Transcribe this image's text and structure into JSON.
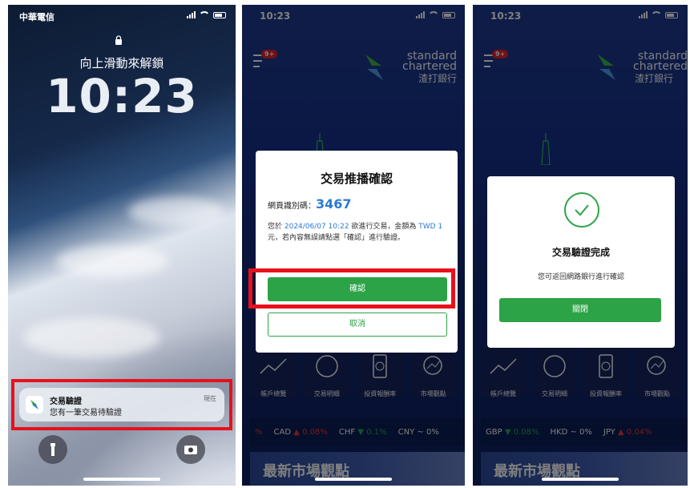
{
  "phone1": {
    "carrier": "中華電信",
    "unlock_hint": "向上滑動來解鎖",
    "time": "10:23",
    "notification": {
      "app": "交易驗證",
      "body": "您有一筆交易待驗證",
      "time": "現在"
    }
  },
  "app_common": {
    "time": "10:23",
    "badge": "9+",
    "brand_line1": "standard",
    "brand_line2": "chartered",
    "brand_cn": "渣打銀行",
    "tiles": [
      "帳戶總覽",
      "交易明細",
      "投資報酬率",
      "市場觀點"
    ],
    "banner": "最新市場觀點"
  },
  "phone2": {
    "ticker": [
      {
        "code": "%",
        "arrow": "",
        "change": ""
      },
      {
        "code": "CAD",
        "arrow": "▲",
        "change": "0.08%"
      },
      {
        "code": "CHF",
        "arrow": "▼",
        "change": "0.1%"
      },
      {
        "code": "CNY",
        "arrow": "~",
        "change": "0%"
      }
    ],
    "dialog": {
      "title": "交易推播確認",
      "code_label": "網頁識別碼：",
      "code": "3467",
      "text_pre": "您於 ",
      "datetime": "2024/06/07 10:22",
      "text_mid": " 欲進行交易，金額為 ",
      "amount": "TWD 1",
      "text_post": " 元，若內容無誤請點選「確認」進行驗證。",
      "confirm": "確認",
      "cancel": "取消"
    }
  },
  "phone3": {
    "ticker": [
      {
        "code": "GBP",
        "arrow": "▼",
        "change": "0.08%"
      },
      {
        "code": "HKD",
        "arrow": "~",
        "change": "0%"
      },
      {
        "code": "JPY",
        "arrow": "▲",
        "change": "0.04%"
      }
    ],
    "dialog": {
      "title": "交易驗證完成",
      "subtitle": "您可返回網路銀行進行確認",
      "close": "關閉"
    }
  },
  "colors": {
    "highlight": "#e8101b",
    "green": "#2ca346",
    "link_blue": "#2a7ad6",
    "app_blue": "#16308a"
  }
}
